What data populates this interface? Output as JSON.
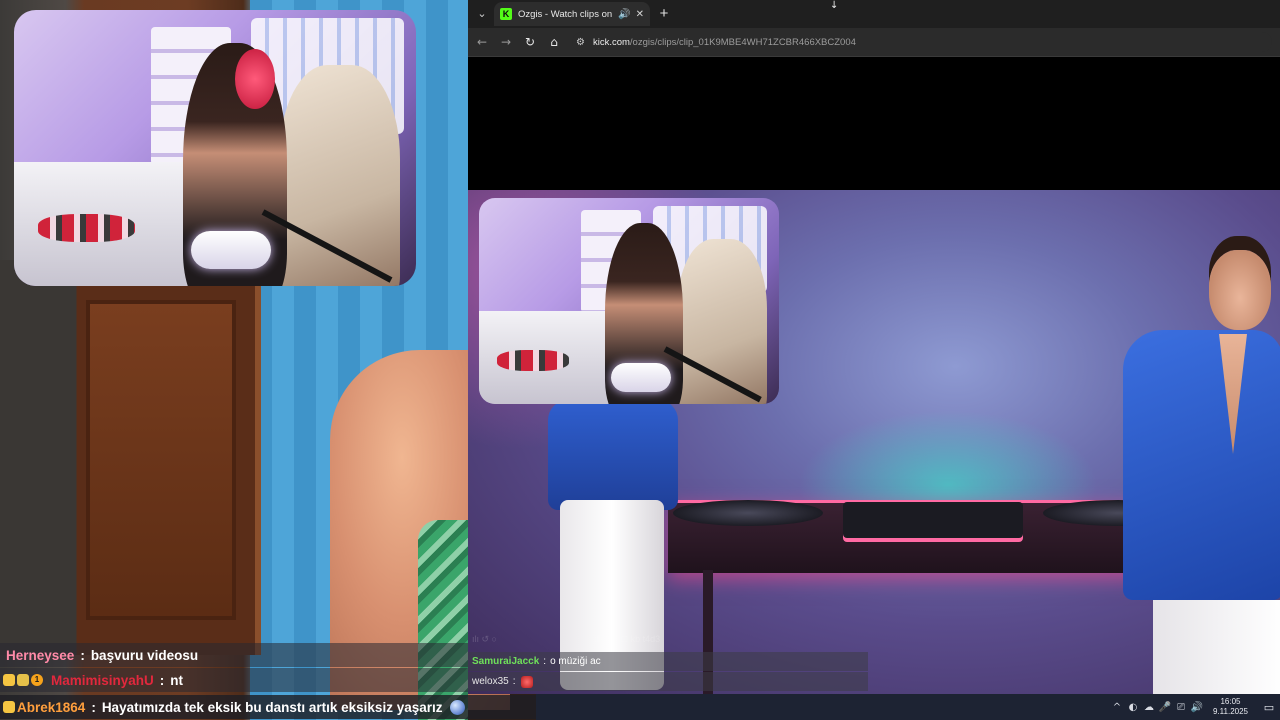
{
  "browser": {
    "tab": {
      "title": "Ozgis - Watch clips on Kick",
      "favicon": "K",
      "audio_icon": "speaker-icon",
      "close_symbol": "✕"
    },
    "new_tab_symbol": "+",
    "dropdown_symbol": "⌄",
    "nav": {
      "back": "←",
      "forward": "→",
      "reload": "↻",
      "home": "⌂"
    },
    "address": {
      "domain": "kick.com",
      "path": "/ozgis/clips/clip_01K9MBE4WH71ZCBR466XBCZ004"
    }
  },
  "clip_chat": {
    "faded_left": "ılı ↺ ○",
    "faded_right": "dkk ⊡ ⊡ kb t4d3",
    "rows": [
      {
        "user": "SamuraiJacck",
        "message": "o müziği ac"
      },
      {
        "user": "welox35",
        "message": ""
      }
    ]
  },
  "stream_chat": {
    "rows": [
      {
        "user": "Herneysee",
        "message": "başvuru videosu"
      },
      {
        "user": "MamimisinyahU",
        "message": "nt",
        "badge_number": "1"
      },
      {
        "user": "Abrek1864",
        "message": "Hayatımızda tek eksik bu danstı artık eksiksiz yaşarız"
      }
    ]
  },
  "taskbar": {
    "tray_icons": [
      "^",
      "◐",
      "☁",
      "🎤",
      "⎚",
      "🔊"
    ],
    "time": "16:05",
    "date": "9.11.2025",
    "notification_icon": "▭"
  },
  "colors": {
    "kick_green": "#53fc18",
    "chat_user_green": "#6fe05a",
    "chat_user_pink": "#ff8aa8",
    "chat_user_red": "#e2283d",
    "chat_user_orange": "#ff9f3d",
    "taskbar": "#1d2333",
    "browser_tabstrip": "#1f1f1f"
  }
}
